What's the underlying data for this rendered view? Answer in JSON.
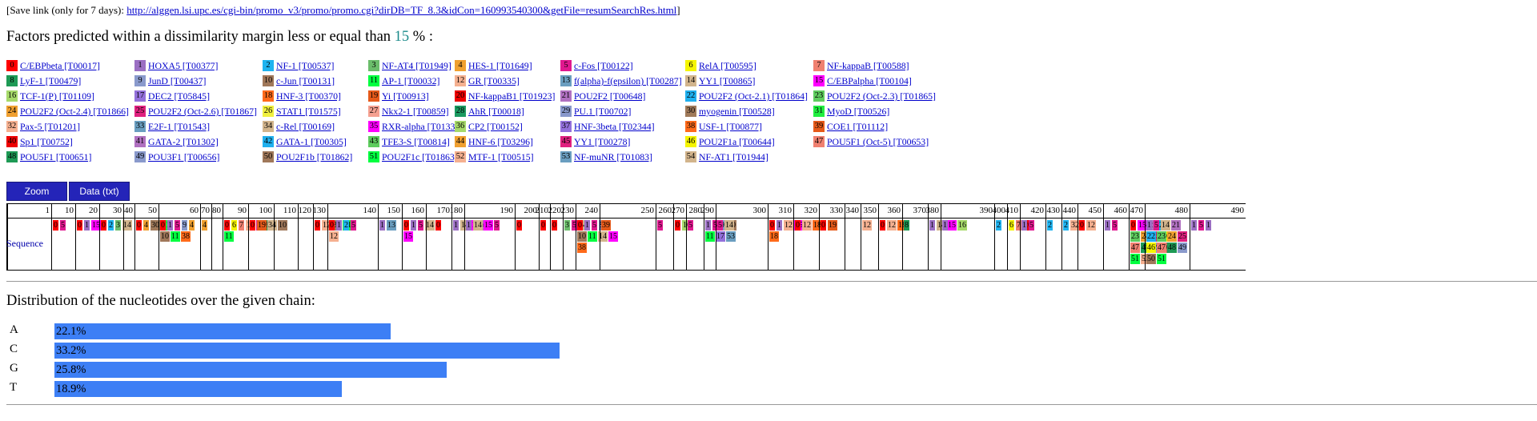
{
  "save": {
    "prefix": "[Save link (only for 7 days): ",
    "url": "http://alggen.lsi.upc.es/cgi-bin/promo_v3/promo/promo.cgi?dirDB=TF_8.3&idCon=160993540300&getFile=resumSearchRes.html",
    "suffix": "]"
  },
  "heading": {
    "before": "Factors predicted within a dissimilarity margin less or equal than ",
    "value": "15",
    "after": " % :"
  },
  "legend": [
    {
      "n": "0",
      "name": "C/EBPbeta [T00017]",
      "color": "#ff0000"
    },
    {
      "n": "1",
      "name": "HOXA5 [T00377]",
      "color": "#9b6fc3"
    },
    {
      "n": "2",
      "name": "NF-1 [T00537]",
      "color": "#1fb3ef"
    },
    {
      "n": "3",
      "name": "NF-AT4 [T01949]",
      "color": "#6bbd6b"
    },
    {
      "n": "4",
      "name": "HES-1 [T01649]",
      "color": "#f0a030"
    },
    {
      "n": "5",
      "name": "c-Fos [T00122]",
      "color": "#e0188f"
    },
    {
      "n": "6",
      "name": "RelA [T00595]",
      "color": "#f5f500"
    },
    {
      "n": "7",
      "name": "NF-kappaB [T00588]",
      "color": "#f08070"
    },
    {
      "n": "8",
      "name": "LyF-1 [T00479]",
      "color": "#1e9a55"
    },
    {
      "n": "9",
      "name": "JunD [T00437]",
      "color": "#8a9acc"
    },
    {
      "n": "10",
      "name": "c-Jun [T00131]",
      "color": "#a0785a"
    },
    {
      "n": "11",
      "name": "AP-1 [T00032]",
      "color": "#00ff40"
    },
    {
      "n": "12",
      "name": "GR [T00335]",
      "color": "#f5b090"
    },
    {
      "n": "13",
      "name": "f(alpha)-f(epsilon) [T00287]",
      "color": "#6a9ec0"
    },
    {
      "n": "14",
      "name": "YY1 [T00865]",
      "color": "#d2b48c"
    },
    {
      "n": "15",
      "name": "C/EBPalpha [T00104]",
      "color": "#ff00ff"
    },
    {
      "n": "16",
      "name": "TCF-1(P) [T01109]",
      "color": "#a6d96a"
    },
    {
      "n": "17",
      "name": "DEC2 [T05845]",
      "color": "#9370db"
    },
    {
      "n": "18",
      "name": "HNF-3 [T00370]",
      "color": "#ff6a1a"
    },
    {
      "n": "19",
      "name": "Yi [T00913]",
      "color": "#e65a1a"
    },
    {
      "n": "20",
      "name": "NF-kappaB1 [T01923]",
      "color": "#ee0000"
    },
    {
      "n": "21",
      "name": "POU2F2 [T00648]",
      "color": "#b070c0"
    },
    {
      "n": "22",
      "name": "POU2F2 (Oct-2.1) [T01864]",
      "color": "#20b0ee"
    },
    {
      "n": "23",
      "name": "POU2F2 (Oct-2.3) [T01865]",
      "color": "#5ecc5e"
    },
    {
      "n": "24",
      "name": "POU2F2 (Oct-2.4) [T01866]",
      "color": "#f0a030"
    },
    {
      "n": "25",
      "name": "POU2F2 (Oct-2.6) [T01867]",
      "color": "#e0207f"
    },
    {
      "n": "26",
      "name": "STAT1 [T01575]",
      "color": "#f0f040"
    },
    {
      "n": "27",
      "name": "Nkx2-1 [T00859]",
      "color": "#f5a090"
    },
    {
      "n": "28",
      "name": "AhR [T00018]",
      "color": "#1a9a60"
    },
    {
      "n": "29",
      "name": "PU.1 [T00702]",
      "color": "#8898cc"
    },
    {
      "n": "30",
      "name": "myogenin [T00528]",
      "color": "#a07a5a"
    },
    {
      "n": "31",
      "name": "MyoD [T00526]",
      "color": "#20ee40"
    },
    {
      "n": "32",
      "name": "Pax-5 [T01201]",
      "color": "#f5b090"
    },
    {
      "n": "33",
      "name": "E2F-1 [T01543]",
      "color": "#6a9ec0"
    },
    {
      "n": "34",
      "name": "c-Rel [T00169]",
      "color": "#d2b48c"
    },
    {
      "n": "35",
      "name": "RXR-alpha [T01331]",
      "color": "#ff00ff"
    },
    {
      "n": "36",
      "name": "CP2 [T00152]",
      "color": "#a6d96a"
    },
    {
      "n": "37",
      "name": "HNF-3beta [T02344]",
      "color": "#9370db"
    },
    {
      "n": "38",
      "name": "USF-1 [T00877]",
      "color": "#ff6a1a"
    },
    {
      "n": "39",
      "name": "COE1 [T01112]",
      "color": "#e65a1a"
    },
    {
      "n": "40",
      "name": "Sp1 [T00752]",
      "color": "#ee0000"
    },
    {
      "n": "41",
      "name": "GATA-2 [T01302]",
      "color": "#b070c0"
    },
    {
      "n": "42",
      "name": "GATA-1 [T00305]",
      "color": "#20b0ee"
    },
    {
      "n": "43",
      "name": "TFE3-S [T00814]",
      "color": "#5ecc5e"
    },
    {
      "n": "44",
      "name": "HNF-6 [T03296]",
      "color": "#f0a030"
    },
    {
      "n": "45",
      "name": "YY1 [T00278]",
      "color": "#e0207f"
    },
    {
      "n": "46",
      "name": "POU2F1a [T00644]",
      "color": "#f5f500"
    },
    {
      "n": "47",
      "name": "POU5F1 (Oct-5) [T00653]",
      "color": "#f08070"
    },
    {
      "n": "48",
      "name": "POU5F1 [T00651]",
      "color": "#1e9a55"
    },
    {
      "n": "49",
      "name": "POU3F1 [T00656]",
      "color": "#8a9acc"
    },
    {
      "n": "50",
      "name": "POU2F1b [T01862]",
      "color": "#a0785a"
    },
    {
      "n": "51",
      "name": "POU2F1c [T01863]",
      "color": "#00ff40"
    },
    {
      "n": "52",
      "name": "MTF-1 [T00515]",
      "color": "#f5b090"
    },
    {
      "n": "53",
      "name": "NF-muNR [T01083]",
      "color": "#6a9ec0"
    },
    {
      "n": "54",
      "name": "NF-AT1 [T01944]",
      "color": "#d2b48c"
    }
  ],
  "buttons": {
    "zoom": "Zoom",
    "data": "Data (txt)"
  },
  "sequence": {
    "row_label": "Sequence",
    "ticks": [
      "1",
      "10",
      "20",
      "30",
      "40",
      "50",
      "60",
      "70",
      "80",
      "90",
      "100",
      "110",
      "120",
      "130",
      "140",
      "150",
      "160",
      "170",
      "180",
      "190",
      "200",
      "210",
      "220",
      "230",
      "240",
      "250",
      "260",
      "270",
      "280",
      "290",
      "300",
      "310",
      "320",
      "330",
      "340",
      "350",
      "360",
      "370",
      "380",
      "390",
      "400",
      "410",
      "420",
      "430",
      "440",
      "450",
      "460",
      "470",
      "480",
      "490"
    ],
    "columns": [
      [
        [
          "0",
          "5"
        ]
      ],
      [
        [
          "0",
          "1",
          "15"
        ]
      ],
      [
        [
          "0",
          "2",
          "3",
          "14"
        ]
      ],
      [],
      [
        [
          "0",
          "4",
          "30",
          "31"
        ]
      ],
      [
        [
          "0",
          "1",
          "5",
          "9",
          "4"
        ],
        [
          "10",
          "11",
          "38"
        ]
      ],
      [
        [
          "4"
        ]
      ],
      [],
      [
        [
          "0",
          "6",
          "7",
          "12",
          "5",
          "8",
          "9",
          "10"
        ],
        [
          "11"
        ]
      ],
      [
        [
          "0",
          "19",
          "34"
        ]
      ],
      [],
      [],
      [
        [
          "0",
          "12",
          "30",
          "31"
        ]
      ],
      [
        [
          "0",
          "1",
          "2",
          "5"
        ],
        [
          "12"
        ]
      ],
      [
        [
          "1",
          "13"
        ]
      ],
      [
        [
          "0",
          "1",
          "5",
          "14",
          "0"
        ],
        [
          "15"
        ]
      ],
      [],
      [
        [
          "1",
          "14",
          "15",
          "41"
        ]
      ],
      [
        [
          "1",
          "14",
          "15",
          "5"
        ]
      ],
      [
        [
          "0"
        ]
      ],
      [
        [
          "0"
        ]
      ],
      [
        [
          "0"
        ]
      ],
      [
        [
          "3",
          "5",
          "54"
        ]
      ],
      [
        [
          "0",
          "1",
          "5",
          "9"
        ],
        [
          "10",
          "11",
          "14",
          "15"
        ],
        [
          "38"
        ]
      ],
      [
        [
          "39"
        ]
      ],
      [
        [
          "5"
        ]
      ],
      [
        [
          "0",
          "16"
        ]
      ],
      [
        [
          "5"
        ]
      ],
      [
        [
          "1",
          "5",
          "9",
          "10"
        ],
        [
          "11",
          "17",
          "53"
        ]
      ],
      [
        [
          "5",
          "14"
        ]
      ],
      [
        [
          "0",
          "1",
          "12",
          "15"
        ],
        [
          "18"
        ]
      ],
      [
        [
          "0",
          "12",
          "18"
        ]
      ],
      [
        [
          "0",
          "19"
        ]
      ],
      [],
      [
        [
          "12"
        ]
      ],
      [
        [
          "0",
          "12",
          "18"
        ]
      ],
      [
        [
          "8"
        ]
      ],
      [
        [
          "1",
          "14",
          "15",
          "16"
        ]
      ],
      [
        [
          "1"
        ]
      ],
      [
        [
          "2"
        ]
      ],
      [
        [
          "6",
          "7",
          "20"
        ]
      ],
      [
        [
          "1",
          "5"
        ]
      ],
      [
        [
          "2"
        ]
      ],
      [
        [
          "2",
          "32"
        ]
      ],
      [
        [
          "0",
          "12"
        ]
      ],
      [
        [
          "1",
          "5"
        ]
      ],
      [
        [
          "0",
          "15",
          "21",
          "22"
        ],
        [
          "23",
          "24",
          "25",
          "46"
        ],
        [
          "47",
          "48",
          "49",
          "50"
        ],
        [
          "51",
          "52"
        ]
      ],
      [
        [
          "1",
          "5",
          "14",
          "21"
        ],
        [
          "22",
          "23",
          "24",
          "25"
        ],
        [
          "46",
          "47",
          "48",
          "49"
        ],
        [
          "50",
          "51"
        ]
      ],
      [
        [
          "1",
          "5",
          "1"
        ]
      ]
    ]
  },
  "distribution": {
    "title": "Distribution of the nucleotides over the given chain:",
    "rows": [
      {
        "base": "A",
        "pct": 22.1,
        "label": "22.1%"
      },
      {
        "base": "C",
        "pct": 33.2,
        "label": "33.2%"
      },
      {
        "base": "G",
        "pct": 25.8,
        "label": "25.8%"
      },
      {
        "base": "T",
        "pct": 18.9,
        "label": "18.9%"
      }
    ]
  }
}
